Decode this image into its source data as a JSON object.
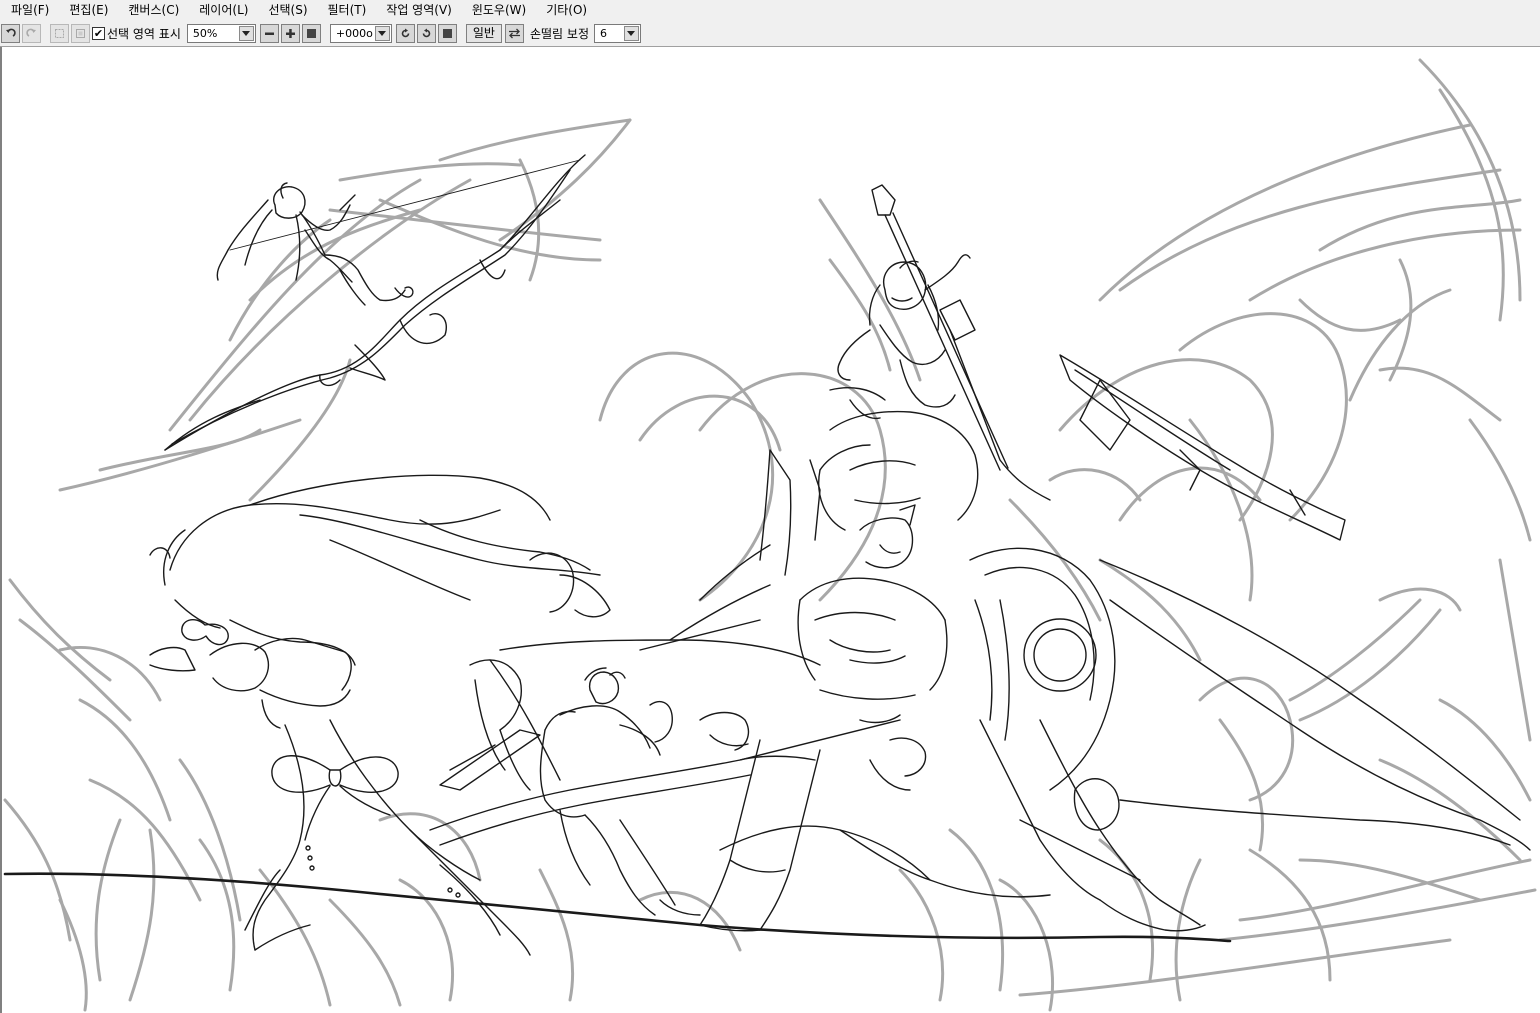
{
  "menu": [
    {
      "label": "파일(F)",
      "key": "file"
    },
    {
      "label": "편집(E)",
      "key": "edit"
    },
    {
      "label": "캔버스(C)",
      "key": "canvas"
    },
    {
      "label": "레이어(L)",
      "key": "layer"
    },
    {
      "label": "선택(S)",
      "key": "select"
    },
    {
      "label": "필터(T)",
      "key": "filter"
    },
    {
      "label": "작업 영역(V)",
      "key": "workspace"
    },
    {
      "label": "윈도우(W)",
      "key": "window"
    },
    {
      "label": "기타(O)",
      "key": "other"
    }
  ],
  "toolbar": {
    "show_selection_label": "선택 영역 표시",
    "show_selection_checked": true,
    "zoom_value": "50%",
    "rotation_value": "+000o",
    "mode_label": "일반",
    "stabilizer_label": "손떨림 보정",
    "stabilizer_value": "6"
  },
  "icons": {
    "undo": "undo-icon",
    "redo": "redo-icon",
    "deselect": "deselect-icon",
    "invert": "invert-selection-icon",
    "zoom_out": "minus-icon",
    "zoom_in": "plus-icon",
    "zoom_reset": "square-icon",
    "rotate_ccw": "rotate-left-icon",
    "rotate_cw": "rotate-right-icon",
    "rotate_reset": "square-icon",
    "flip": "flip-horizontal-icon"
  },
  "colors": {
    "chrome": "#f0f0f0",
    "ink": "#1a1a1a",
    "sketch": "#a8a8a8"
  }
}
